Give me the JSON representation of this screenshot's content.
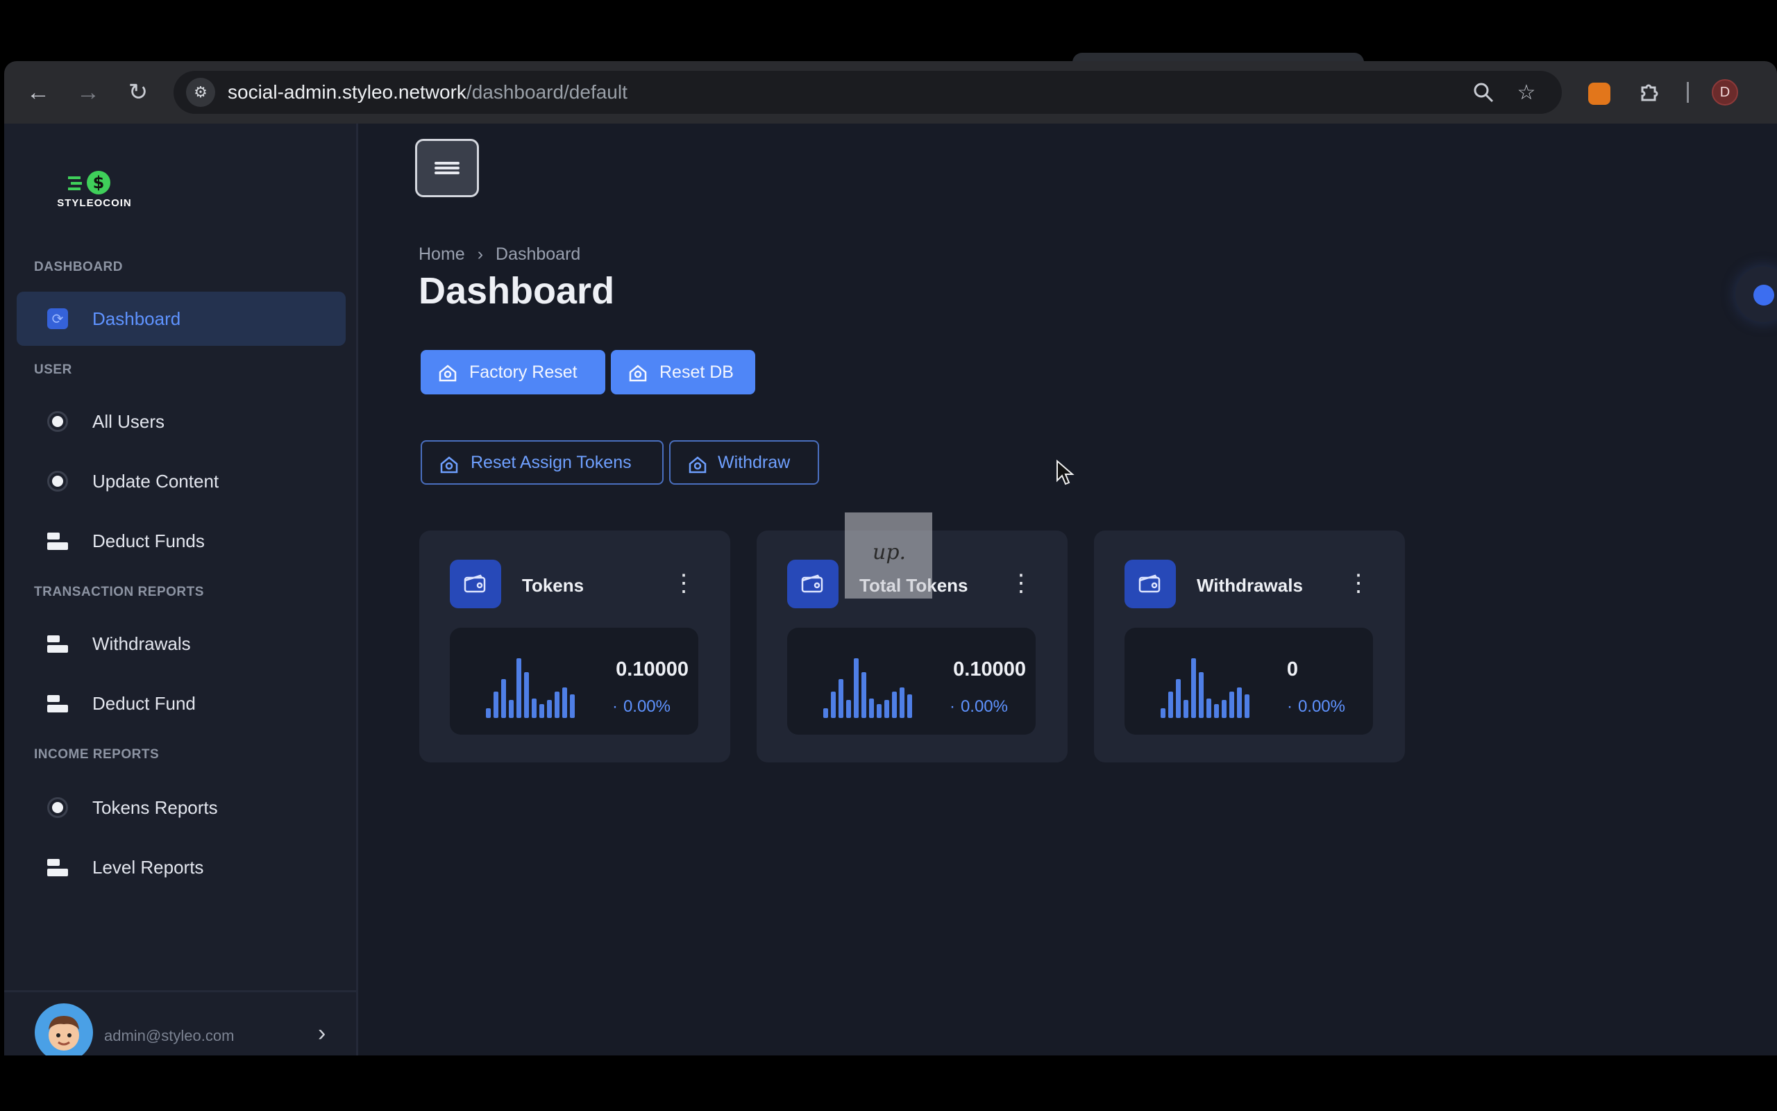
{
  "browser": {
    "url_host": "social-admin.styleo.network",
    "url_path": "/dashboard/default",
    "profile_initial": "D"
  },
  "sidebar": {
    "logo_text": "STYLEOCOIN",
    "sections": {
      "dashboard": "DASHBOARD",
      "user": "USER",
      "transaction_reports": "TRANSACTION REPORTS",
      "income_reports": "INCOME REPORTS"
    },
    "items": {
      "dashboard": "Dashboard",
      "all_users": "All Users",
      "update_content": "Update Content",
      "deduct_funds": "Deduct Funds",
      "withdrawals": "Withdrawals",
      "deduct_fund": "Deduct Fund",
      "tokens_reports": "Tokens Reports",
      "level_reports": "Level Reports"
    },
    "user_email": "admin@styleo.com"
  },
  "main": {
    "breadcrumb": {
      "home": "Home",
      "separator": "›",
      "current": "Dashboard"
    },
    "title": "Dashboard",
    "buttons": {
      "factory_reset": "Factory Reset",
      "reset_db": "Reset DB",
      "reset_assign_tokens": "Reset Assign Tokens",
      "withdraw": "Withdraw"
    },
    "cards": [
      {
        "title": "Tokens",
        "value": "0.10000",
        "change": "0.00%"
      },
      {
        "title": "Total Tokens",
        "value": "0.10000",
        "change": "0.00%"
      },
      {
        "title": "Withdrawals",
        "value": "0",
        "change": "0.00%"
      }
    ],
    "overlay_text": "up."
  },
  "colors": {
    "accent": "#4f86f7",
    "active_text": "#5f93ff",
    "background": "#171b26",
    "sidebar": "#1b1f2b",
    "card": "#212634"
  }
}
